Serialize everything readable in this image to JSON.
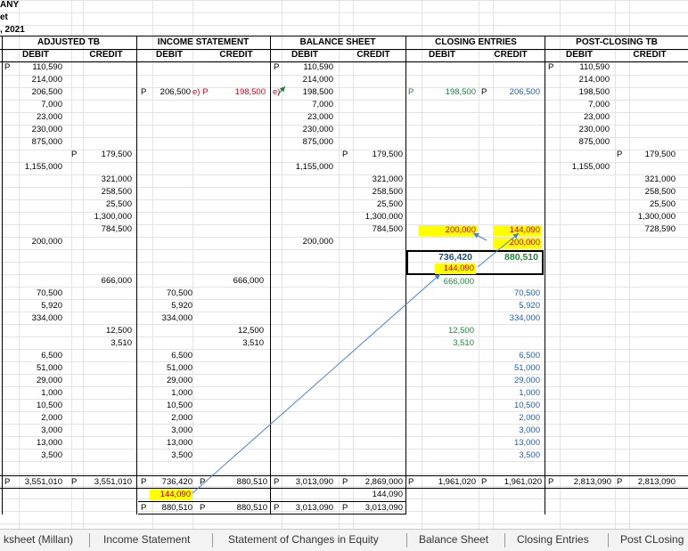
{
  "title": {
    "company": "ANY",
    "subtitle": "et",
    "date": ", 2021"
  },
  "sections": {
    "adjusted": "ADJUSTED TB",
    "income": "INCOME STATEMENT",
    "balance": "BALANCE SHEET",
    "closing": "CLOSING ENTRIES",
    "postclosing": "POST-CLOSING TB"
  },
  "col": {
    "debit": "DEBIT",
    "credit": "CREDIT"
  },
  "marks": {
    "p": "P",
    "pe": "P",
    "ep": "e) P",
    "e": "e)"
  },
  "adj_debit_1": [
    "110,590",
    "214,000",
    "206,500",
    "7,000",
    "23,000",
    "230,000",
    "875,000"
  ],
  "adj_credit_2": "179,500",
  "adj_debit_3": "1,155,000",
  "adj_credit_4": [
    "321,000",
    "258,500",
    "25,500",
    "1,300,000",
    "784,500"
  ],
  "adj_debit_5": "200,000",
  "adj_credit_6": "666,000",
  "adj_debit_7": [
    "70,500",
    "5,920",
    "334,000"
  ],
  "adj_credit_8": [
    "12,500",
    "3,510"
  ],
  "adj_debit_9": [
    "6,500",
    "51,000",
    "29,000",
    "1,000",
    "10,500",
    "2,000",
    "3,000",
    "13,000",
    "3,500"
  ],
  "inc": {
    "is_debit_row": "206,500",
    "is_credit_row": "198,500",
    "is_credit_666": "666,000",
    "debit_a": [
      "70,500",
      "5,920",
      "334,000"
    ],
    "credit_b": [
      "12,500",
      "3,510"
    ],
    "debit_c": [
      "6,500",
      "51,000",
      "29,000",
      "1,000",
      "10,500",
      "2,000",
      "3,000",
      "13,000",
      "3,500"
    ]
  },
  "bs": {
    "debit_1": [
      "110,590",
      "214,000",
      "198,500",
      "7,000",
      "23,000",
      "230,000",
      "875,000"
    ],
    "credit_2": "179,500",
    "debit_3": "1,155,000",
    "credit_4": [
      "321,000",
      "258,500",
      "25,500",
      "1,300,000",
      "784,500"
    ],
    "debit_5": "200,000"
  },
  "ce": {
    "debit_row": "198,500",
    "credit_row": "206,500",
    "hl_debit": "200,000",
    "hl_credit_1": "144,090",
    "hl_credit_2": "200,000",
    "box_debit": "736,420",
    "box_credit": "880,510",
    "hl_debit_2": "144,090",
    "debit_666": "666,000",
    "credit_a": [
      "70,500",
      "5,920",
      "334,000"
    ],
    "debit_b": [
      "12,500",
      "3,510"
    ],
    "credit_c": [
      "6,500",
      "51,000",
      "29,000",
      "1,000",
      "10,500",
      "2,000",
      "3,000",
      "13,000",
      "3,500"
    ]
  },
  "pc": {
    "debit_1": [
      "110,590",
      "214,000",
      "198,500",
      "7,000",
      "23,000",
      "230,000",
      "875,000"
    ],
    "credit_2": "179,500",
    "debit_3": "1,155,000",
    "credit_4": [
      "321,000",
      "258,500",
      "25,500",
      "1,300,000",
      "728,590"
    ]
  },
  "totals": {
    "adj_debit": "3,551,010",
    "adj_credit": "3,551,010",
    "is_debit": "736,420",
    "is_credit": "880,510",
    "bs_debit": "3,013,090",
    "bs_credit": "2,869,000",
    "ce_debit": "1,961,020",
    "ce_credit": "1,961,020",
    "pc_debit": "2,813,090",
    "pc_credit": "2,813,090",
    "is_net": "144,090",
    "bs_net": "144,090",
    "is_final_debit": "880,510",
    "is_final_credit": "880,510",
    "bs_final_debit": "3,013,090",
    "bs_final_credit": "3,013,090"
  },
  "colors": {
    "highlight": "#ffff00",
    "green": "#1a8a3a",
    "blue": "#1f5fbf",
    "red": "#d8001a",
    "arrow": "#4a7fd6"
  },
  "tabs": [
    "ksheet (Millan)",
    "Income Statement",
    "Statement of Changes in Equity",
    "Balance Sheet",
    "Closing Entries",
    "Post CLosing"
  ]
}
